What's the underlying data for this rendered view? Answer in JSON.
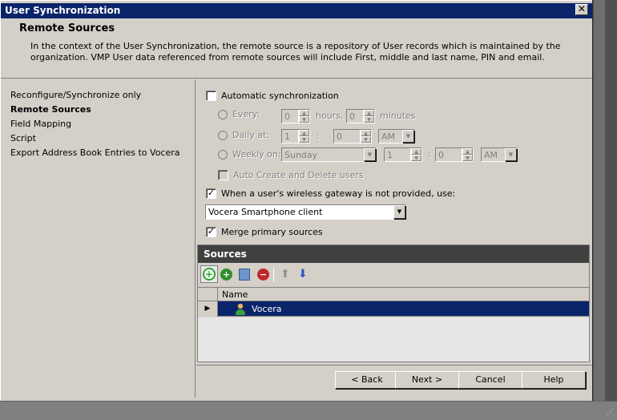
{
  "window": {
    "title": "User Synchronization",
    "close_glyph": "✕"
  },
  "header": {
    "heading": "Remote Sources",
    "description": "In the context of the User Synchronization, the remote source is a repository of User records which is maintained by the organization. VMP User data referenced from remote sources will include First, middle and last name, PIN and email."
  },
  "nav": {
    "items": [
      {
        "label": "Reconfigure/Synchronize only",
        "active": false
      },
      {
        "label": "Remote Sources",
        "active": true
      },
      {
        "label": "Field Mapping",
        "active": false
      },
      {
        "label": "Script",
        "active": false
      },
      {
        "label": "Export Address Book Entries to Vocera",
        "active": false
      }
    ]
  },
  "sync": {
    "auto_label": "Automatic synchronization",
    "auto_checked": false,
    "every_label": "Every:",
    "every_hours": "0",
    "hours_label": "hours,",
    "every_minutes": "0",
    "minutes_label": "minutes",
    "daily_label": "Daily at:",
    "daily_hour": "1",
    "daily_minute": "0",
    "daily_ampm": "AM",
    "weekly_label": "Weekly on:",
    "weekly_day": "Sunday",
    "weekly_hour": "1",
    "weekly_minute": "0",
    "weekly_ampm": "AM",
    "colon": ":",
    "auto_create_label": "Auto Create and Delete users"
  },
  "gateway": {
    "label": "When a user's wireless gateway is not provided, use:",
    "checked": true,
    "selected": "Vocera Smartphone client"
  },
  "merge": {
    "label": "Merge primary sources",
    "checked": true
  },
  "check_glyph": "✓",
  "sources": {
    "header": "Sources",
    "column_name": "Name",
    "rows": [
      {
        "name": "Vocera",
        "marker": "▶"
      }
    ]
  },
  "footer": {
    "back": "< Back",
    "next": "Next >",
    "cancel": "Cancel",
    "help": "Help"
  },
  "colors": {
    "titlebar": "#0a246a",
    "selection": "#0a246a",
    "panel_header": "#404040"
  }
}
